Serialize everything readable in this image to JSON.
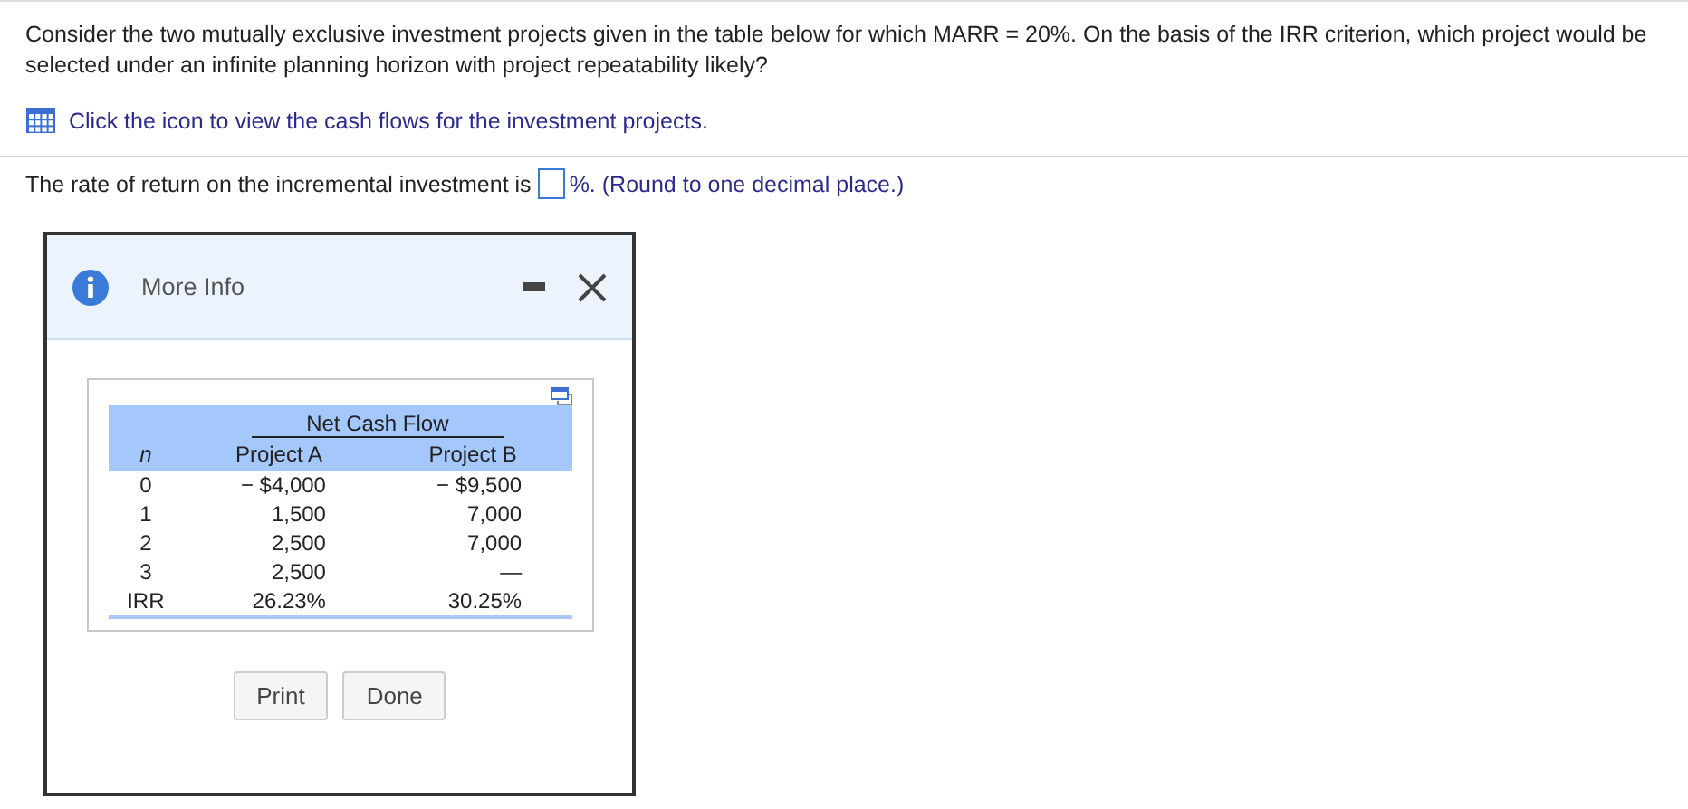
{
  "question": "Consider the two mutually exclusive investment projects given in the table below for which MARR = 20%. On the basis of the IRR criterion, which project would be selected under an infinite planning horizon with project repeatability likely?",
  "table_link": "Click the icon to view the cash flows for the investment projects.",
  "answer": {
    "prefix": "The rate of return on the incremental investment is",
    "suffix": "%. (Round to one decimal place.)"
  },
  "dialog": {
    "title": "More Info",
    "table": {
      "group_header": "Net Cash Flow",
      "columns": [
        "n",
        "Project A",
        "Project B"
      ],
      "rows": [
        [
          "0",
          "− $4,000",
          "− $9,500"
        ],
        [
          "1",
          "1,500",
          "7,000"
        ],
        [
          "2",
          "2,500",
          "7,000"
        ],
        [
          "3",
          "2,500",
          "—"
        ],
        [
          "IRR",
          "26.23%",
          "30.25%"
        ]
      ]
    },
    "buttons": [
      "Print",
      "Done"
    ]
  }
}
